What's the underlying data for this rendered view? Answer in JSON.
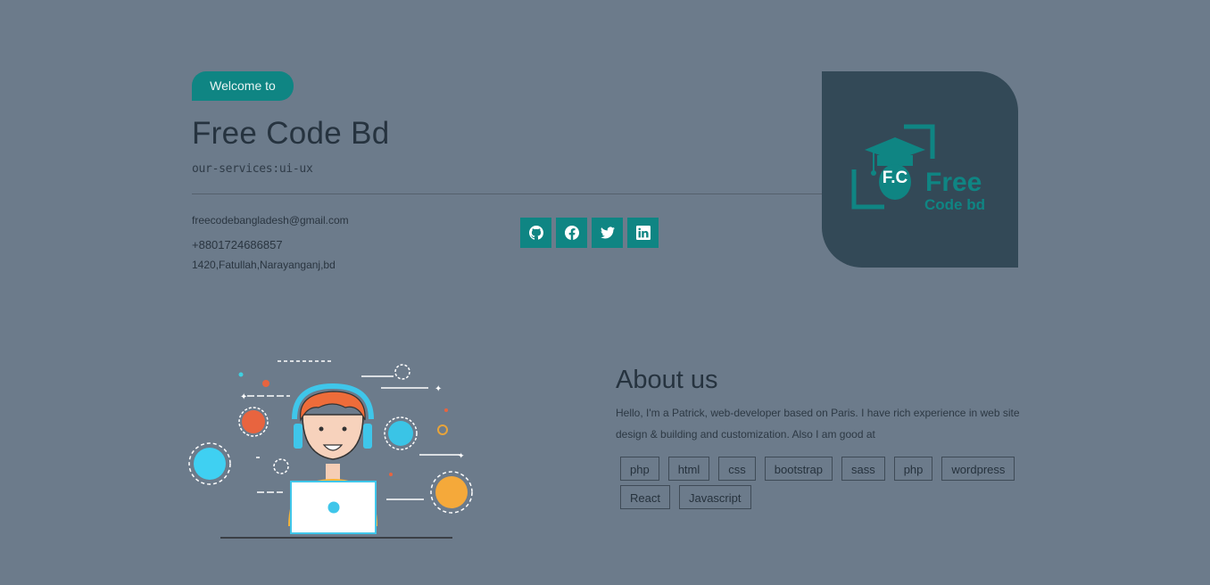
{
  "hero": {
    "welcome_label": "Welcome to",
    "title": "Free Code Bd",
    "services": "our-services:ui-ux"
  },
  "contact": {
    "email": "freecodebangladesh@gmail.com",
    "phone": "+8801724686857",
    "address": "1420,Fatullah,Narayanganj,bd"
  },
  "socials": [
    {
      "icon": "github-icon"
    },
    {
      "icon": "facebook-icon"
    },
    {
      "icon": "twitter-icon"
    },
    {
      "icon": "linkedin-icon"
    }
  ],
  "logo": {
    "initials": "F.C",
    "word1": "Free",
    "word2": "Code bd"
  },
  "about": {
    "title": "About us",
    "text": "Hello, I'm a Patrick, web-developer based on Paris. I have rich experience in web site design & building and customization. Also I am good at",
    "skills": [
      "php",
      "html",
      "css",
      "bootstrap",
      "sass",
      "php",
      "wordpress",
      "React",
      "Javascript"
    ]
  },
  "colors": {
    "background": "#6c7b8b",
    "accent": "#0f8583",
    "logo_card": "#334957"
  }
}
